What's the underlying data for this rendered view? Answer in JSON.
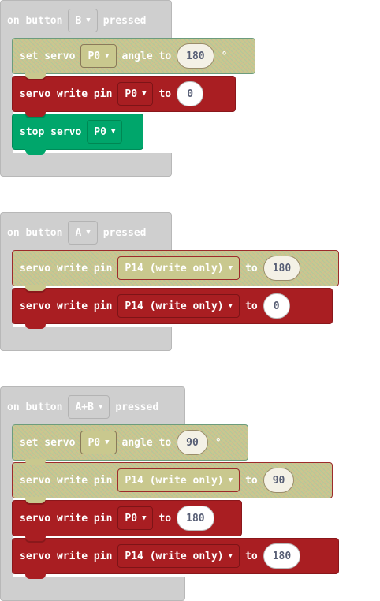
{
  "scripts": [
    {
      "hat": {
        "prefix": "on button",
        "button": "B",
        "suffix": "pressed"
      },
      "blocks": [
        {
          "style": "hatch",
          "label": "set servo",
          "pin": "P0",
          "mid": "angle to",
          "value": "180",
          "unit": "°"
        },
        {
          "style": "red",
          "label": "servo write pin",
          "pin": "P0",
          "mid": "to",
          "value": "0"
        },
        {
          "style": "green",
          "label": "stop servo",
          "pin": "P0"
        }
      ]
    },
    {
      "hat": {
        "prefix": "on button",
        "button": "A",
        "suffix": "pressed"
      },
      "blocks": [
        {
          "style": "hatch",
          "label": "servo write pin",
          "pin": "P14 (write only)",
          "mid": "to",
          "value": "180"
        },
        {
          "style": "red",
          "label": "servo write pin",
          "pin": "P14 (write only)",
          "mid": "to",
          "value": "0"
        }
      ]
    },
    {
      "hat": {
        "prefix": "on button",
        "button": "A+B",
        "suffix": "pressed"
      },
      "blocks": [
        {
          "style": "hatch",
          "label": "set servo",
          "pin": "P0",
          "mid": "angle to",
          "value": "90",
          "unit": "°"
        },
        {
          "style": "hatch",
          "label": "servo write pin",
          "pin": "P14 (write only)",
          "mid": "to",
          "value": "90"
        },
        {
          "style": "red",
          "label": "servo write pin",
          "pin": "P0",
          "mid": "to",
          "value": "180"
        },
        {
          "style": "red",
          "label": "servo write pin",
          "pin": "P14 (write only)",
          "mid": "to",
          "value": "180"
        }
      ]
    }
  ]
}
